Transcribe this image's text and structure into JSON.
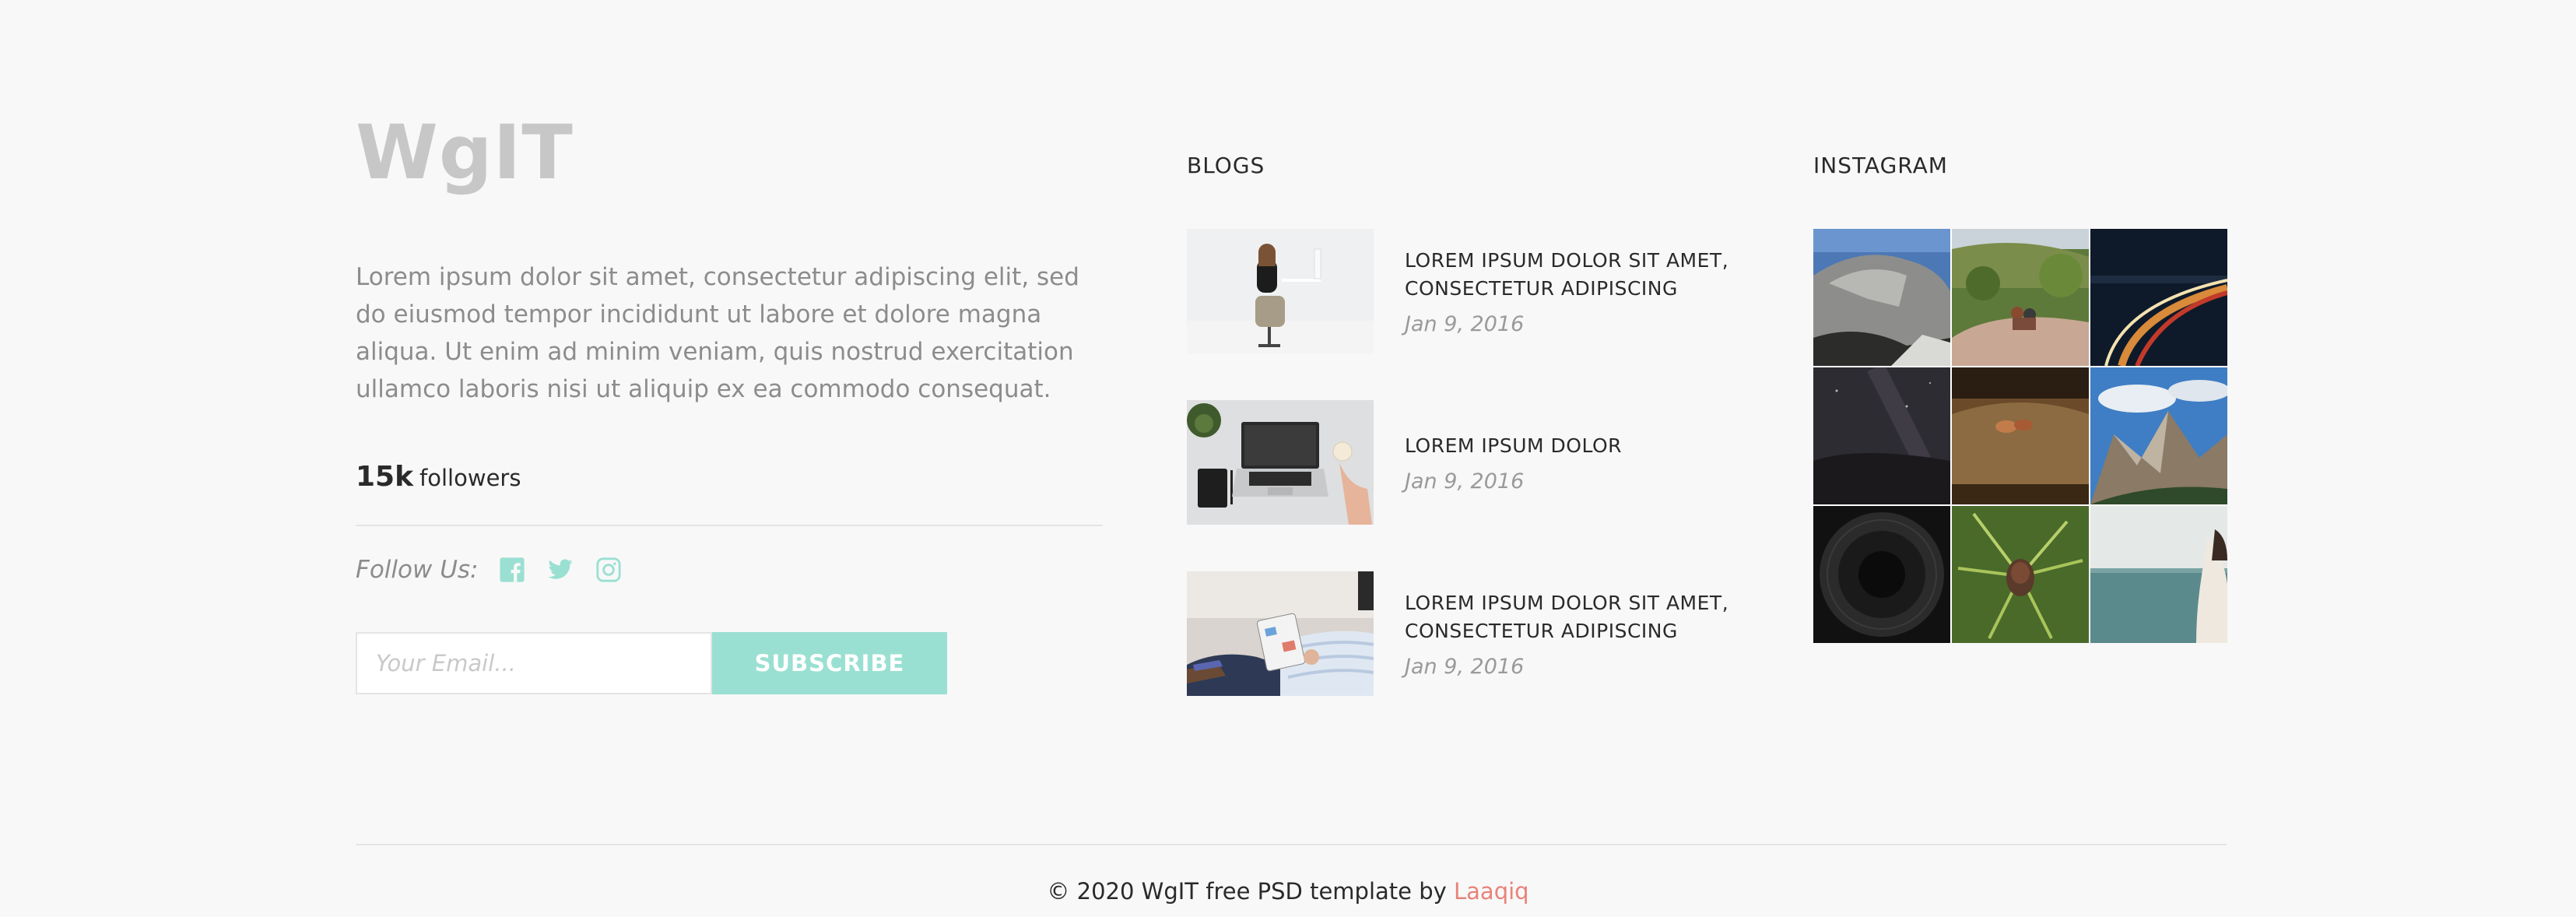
{
  "brand": {
    "name": "WgIT"
  },
  "about": {
    "text": "Lorem ipsum dolor sit amet, consectetur adipiscing elit, sed do eiusmod tempor incididunt ut labore et dolore magna aliqua. Ut enim ad minim veniam, quis nostrud exercitation ullamco laboris nisi ut aliquip ex ea commodo consequat."
  },
  "followers": {
    "count": "15k",
    "label": "followers"
  },
  "follow": {
    "label": "Follow Us:",
    "icons": [
      "facebook-icon",
      "twitter-icon",
      "instagram-icon"
    ],
    "icon_color": "#9ae0d2"
  },
  "subscribe": {
    "placeholder": "Your Email...",
    "button_label": "SUBSCRIBE",
    "button_color": "#9ae0d2"
  },
  "blogs": {
    "heading": "BLOGS",
    "items": [
      {
        "title_line1": "LOREM IPSUM DOLOR SIT AMET,",
        "title_line2": "CONSECTETUR ADIPISCING",
        "date": "Jan 9, 2016",
        "image": "woman-at-desk"
      },
      {
        "title_line1": "LOREM IPSUM DOLOR",
        "title_line2": "",
        "date": "Jan 9, 2016",
        "image": "laptop-on-desk"
      },
      {
        "title_line1": "LOREM IPSUM DOLOR SIT AMET,",
        "title_line2": "CONSECTETUR ADIPISCING",
        "date": "Jan 9, 2016",
        "image": "man-with-tablet"
      }
    ]
  },
  "instagram": {
    "heading": "INSTAGRAM",
    "photos": [
      "mountain-dome",
      "hikers-on-cliff",
      "night-highway",
      "starry-night",
      "brown-blur",
      "rocky-peaks",
      "dark-tunnel",
      "pine-cone",
      "sea-horizon"
    ]
  },
  "footer": {
    "text": "© 2020 WgIT free PSD template by",
    "link": "Laaqiq",
    "link_color": "#e8837a"
  }
}
